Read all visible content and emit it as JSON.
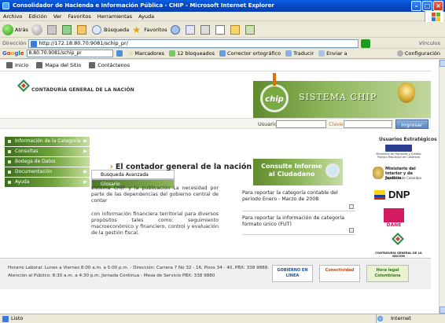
{
  "window": {
    "title": "Consolidador de Hacienda e Información Pública - CHIP - Microsoft Internet Explorer"
  },
  "menu": [
    "Archivo",
    "Edición",
    "Ver",
    "Favoritos",
    "Herramientas",
    "Ayuda"
  ],
  "toolbar": {
    "back": "Atrás",
    "search": "Búsqueda",
    "favorites": "Favoritos"
  },
  "address": {
    "label": "Dirección",
    "url": "http://172.18.80.70:9081/schip_pr/",
    "links": "Vínculos"
  },
  "google_bar": {
    "query": "8.80.70:9081/schip_pr",
    "bookmarks": "Marcadores",
    "blocked": "12 bloqueados",
    "spellcheck": "Corrector ortográfico",
    "translate": "Traducir",
    "send": "Enviar a",
    "settings": "Configuración"
  },
  "site_nav": [
    "Inicio",
    "Mapa del Sitio",
    "Contáctenos"
  ],
  "header": {
    "org": "CONTADURÍA GENERAL DE LA NACIÓN",
    "chip": "chip",
    "system": "SISTEMA CHIP"
  },
  "login": {
    "user_label": "Usuario",
    "pass_label": "Clave",
    "button": "Ingresar"
  },
  "left_menu": [
    "Información de la Categoría",
    "Consultas",
    "Bodega de Datos",
    "Documentación",
    "Ayuda"
  ],
  "submenu": [
    "Busqueda Avanzada",
    "Glosario"
  ],
  "main": {
    "title": "El contador general de la nación",
    "p1": "sistema CHIP y la publicación La necesidad por parte de las dependencias del gobierno central de contar",
    "p2": "con información financiera territorial para diversos propósitos tales como: seguimiento macroeconómico y financiero, control y evaluación de la gestión fiscal."
  },
  "consulte": {
    "title": "Consulte Informe al Ciudadano",
    "report1": "Para reportar la categoría contable del periodo Enero - Marzo de 2008",
    "report2": "Para reportar la información de categoría formato único (FUT)"
  },
  "right": {
    "title": "Usuarios Estratégicos",
    "min_hacienda_small": "Ministerio de Hacienda y Crédito Público República de Colombia",
    "min_interior": "Ministerio del Interior y de Justicia",
    "min_interior_sub": "República de Colombia",
    "dnp": "DNP",
    "dane": "DANE",
    "cgn": "CONTADURÍA GENERAL DE LA NACIÓN"
  },
  "footer": {
    "line1": "Horario Laboral: Lunes a Viernes 8:00 a.m. a 5:00 p.m. - Dirección: Carrera 7 No 32 - 16, Pisos 34 - 40, PBX: 338 9888.",
    "line2": "Atención al Público: 8:30 a.m. a 4:30 p.m. Jornada Continua - Mesa de Servicio PBX: 338 9880",
    "badge1": "GOBIERNO EN LÍNEA",
    "badge2": "Conectividad",
    "badge3": "Hora legal Colombiana"
  },
  "status": {
    "ready": "Listo",
    "zone": "Internet"
  }
}
